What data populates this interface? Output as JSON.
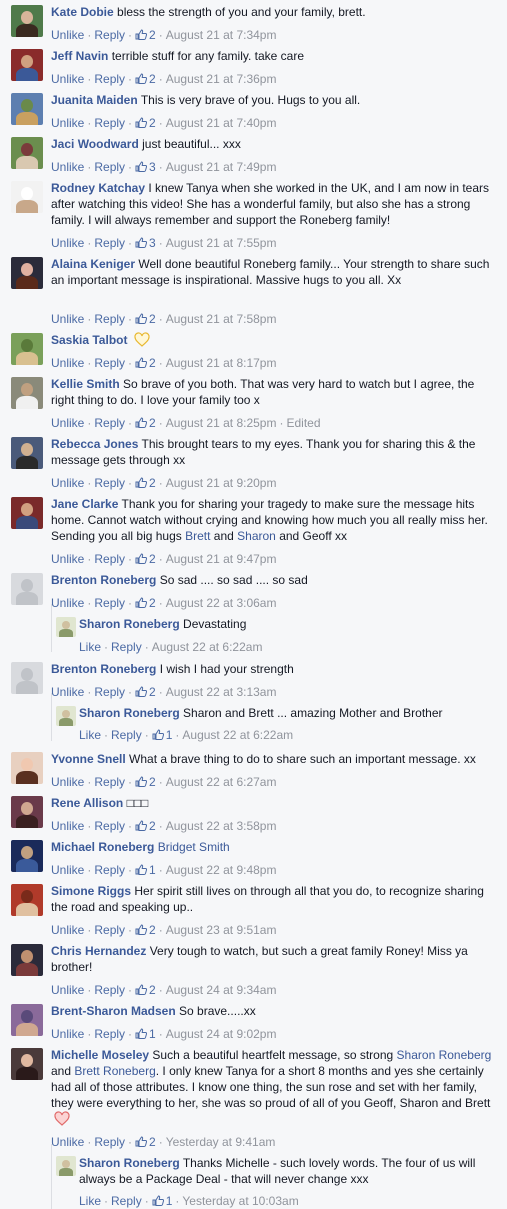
{
  "actions": {
    "unlike": "Unlike",
    "reply": "Reply",
    "like": "Like",
    "separator": "·"
  },
  "comments": [
    {
      "author": "Kate Dobie",
      "text": "bless the strength of you and your family, brett.",
      "likes": "2",
      "date": "August 21 at 7:34pm",
      "liked": true,
      "avatar": [
        "#4f7a4a",
        "#3a2a20",
        "#d8b49a"
      ]
    },
    {
      "author": "Jeff Navin",
      "text": "terrible stuff for any family. take care",
      "likes": "2",
      "date": "August 21 at 7:36pm",
      "liked": true,
      "avatar": [
        "#8a2b2b",
        "#3b5998",
        "#d0a080"
      ]
    },
    {
      "author": "Juanita Maiden",
      "text": "This is very brave of you. Hugs to you all.",
      "likes": "2",
      "date": "August 21 at 7:40pm",
      "liked": true,
      "avatar": [
        "#5d7fb0",
        "#c9a060",
        "#6a8a4a"
      ]
    },
    {
      "author": "Jaci Woodward",
      "text": "just beautiful... xxx",
      "likes": "3",
      "date": "August 21 at 7:49pm",
      "liked": true,
      "avatar": [
        "#6b8e4e",
        "#d9c8b0",
        "#7a3b3b"
      ]
    },
    {
      "author": "Rodney Katchay",
      "text": "I knew Tanya when she worked in the UK, and I am now in tears after watching this video! She has a wonderful family, but also she has a strong family. I will always remember and support the Roneberg family!",
      "likes": "3",
      "date": "August 21 at 7:55pm",
      "liked": true,
      "avatar": [
        "#f2f2f2",
        "#c8a88a",
        "#ffffff"
      ]
    },
    {
      "author": "Alaina Keniger",
      "text": "Well done beautiful Roneberg family... Your strength to share such an important message is inspirational. Massive hugs to you all. Xx",
      "likes": "2",
      "date": "August 21 at 7:58pm",
      "liked": true,
      "avatar": [
        "#2b2b3a",
        "#5a2a1a",
        "#e0b0a0"
      ]
    },
    {
      "author": "Saskia Talbot",
      "text": "",
      "heart": "yellow",
      "likes": "2",
      "date": "August 21 at 8:17pm",
      "liked": true,
      "avatar": [
        "#7aa05a",
        "#d8c090",
        "#5a7a3a"
      ]
    },
    {
      "author": "Kellie Smith",
      "text": "So brave of you both. That was very hard to watch but I agree, the right thing to do. I love your family too x",
      "likes": "2",
      "date": "August 21 at 8:25pm",
      "edited": "Edited",
      "liked": true,
      "avatar": [
        "#8a8a7a",
        "#f0f0f0",
        "#c0a080"
      ]
    },
    {
      "author": "Rebecca Jones",
      "text": "This brought tears to my eyes. Thank you for sharing this & the message gets through xx",
      "likes": "2",
      "date": "August 21 at 9:20pm",
      "liked": true,
      "avatar": [
        "#4a5a7a",
        "#2a2a2a",
        "#d0b090"
      ]
    },
    {
      "author": "Jane Clarke",
      "text_parts": [
        "Thank you for sharing your tragedy to make sure the message hits home. Cannot watch without crying and knowing how much you all really miss her. Sending you all big hugs ",
        "Brett",
        " and ",
        "Sharon",
        " and Geoff xx"
      ],
      "likes": "2",
      "date": "August 21 at 9:47pm",
      "liked": true,
      "avatar": [
        "#7a2a2a",
        "#3a4a7a",
        "#d0a080"
      ]
    },
    {
      "author": "Brenton Roneberg",
      "text": "So sad .... so sad .... so sad",
      "likes": "2",
      "date": "August 22 at 3:06am",
      "liked": true,
      "avatar": [
        "#d8dade",
        "#c0c3c8",
        "#c0c3c8"
      ]
    },
    {
      "reply": true,
      "author": "Sharon Roneberg",
      "text": "Devastating",
      "likes": "",
      "date": "August 22 at 6:22am",
      "liked": false,
      "avatar": [
        "#e0e6d0",
        "#8a9a6a",
        "#d0c0a0"
      ]
    },
    {
      "author": "Brenton Roneberg",
      "text": "I wish I had your strength",
      "likes": "2",
      "date": "August 22 at 3:13am",
      "liked": true,
      "avatar": [
        "#d8dade",
        "#c0c3c8",
        "#c0c3c8"
      ]
    },
    {
      "reply": true,
      "author": "Sharon Roneberg",
      "text": "Sharon and Brett ... amazing Mother and Brother",
      "likes": "1",
      "date": "August 22 at 6:22am",
      "liked": false,
      "avatar": [
        "#e0e6d0",
        "#8a9a6a",
        "#d0c0a0"
      ]
    },
    {
      "author": "Yvonne Snell",
      "text": "What a brave thing to do to share such an important message. xx",
      "likes": "2",
      "date": "August 22 at 6:27am",
      "liked": true,
      "avatar": [
        "#e8d0c0",
        "#5a3020",
        "#f0c8b0"
      ]
    },
    {
      "author": "Rene Allison",
      "text": "□□□",
      "likes": "2",
      "date": "August 22 at 3:58pm",
      "liked": true,
      "avatar": [
        "#6a3a4a",
        "#3a2020",
        "#d0a890"
      ]
    },
    {
      "author": "Michael Roneberg",
      "text": "",
      "tag": "Bridget Smith",
      "likes": "1",
      "date": "August 22 at 9:48pm",
      "liked": true,
      "avatar": [
        "#1a2a5a",
        "#3a5a9a",
        "#c0a080"
      ]
    },
    {
      "author": "Simone Riggs",
      "text": "Her spirit still lives on through all that you do, to recognize sharing the road and speaking up..",
      "likes": "2",
      "date": "August 23 at 9:51am",
      "liked": true,
      "avatar": [
        "#b03a2a",
        "#e0c0a0",
        "#7a2a1a"
      ]
    },
    {
      "author": "Chris Hernandez",
      "text": "Very tough to watch, but such a great family Roney! Miss ya brother!",
      "likes": "2",
      "date": "August 24 at 9:34am",
      "liked": true,
      "avatar": [
        "#2a2a3a",
        "#7a3a3a",
        "#c09070"
      ]
    },
    {
      "author": "Brent-Sharon Madsen",
      "text": "So brave.....xx",
      "likes": "1",
      "date": "August 24 at 9:02pm",
      "liked": true,
      "avatar": [
        "#8a6a9a",
        "#d0a890",
        "#5a4a7a"
      ]
    },
    {
      "author": "Michelle Moseley",
      "text_parts": [
        "Such a beautiful heartfelt message, so strong ",
        "Sharon Roneberg",
        " and ",
        "Brett Roneberg",
        ". I only knew Tanya for a short 8 months and yes she certainly had all of those attributes. I know one thing, the sun rose and set with her family, they were everything to her, she was so proud of all of you Geoff, Sharon and Brett"
      ],
      "heart": "pink",
      "likes": "2",
      "date": "Yesterday at 9:41am",
      "liked": true,
      "avatar": [
        "#4a3a3a",
        "#2a1a1a",
        "#e0b8a0"
      ]
    },
    {
      "reply": true,
      "author": "Sharon Roneberg",
      "text": "Thanks Michelle - such lovely words. The four of us will always be a Package Deal - that will never change xxx",
      "likes": "1",
      "date": "Yesterday at 10:03am",
      "liked": false,
      "avatar": [
        "#e0e6d0",
        "#8a9a6a",
        "#d0c0a0"
      ]
    }
  ]
}
